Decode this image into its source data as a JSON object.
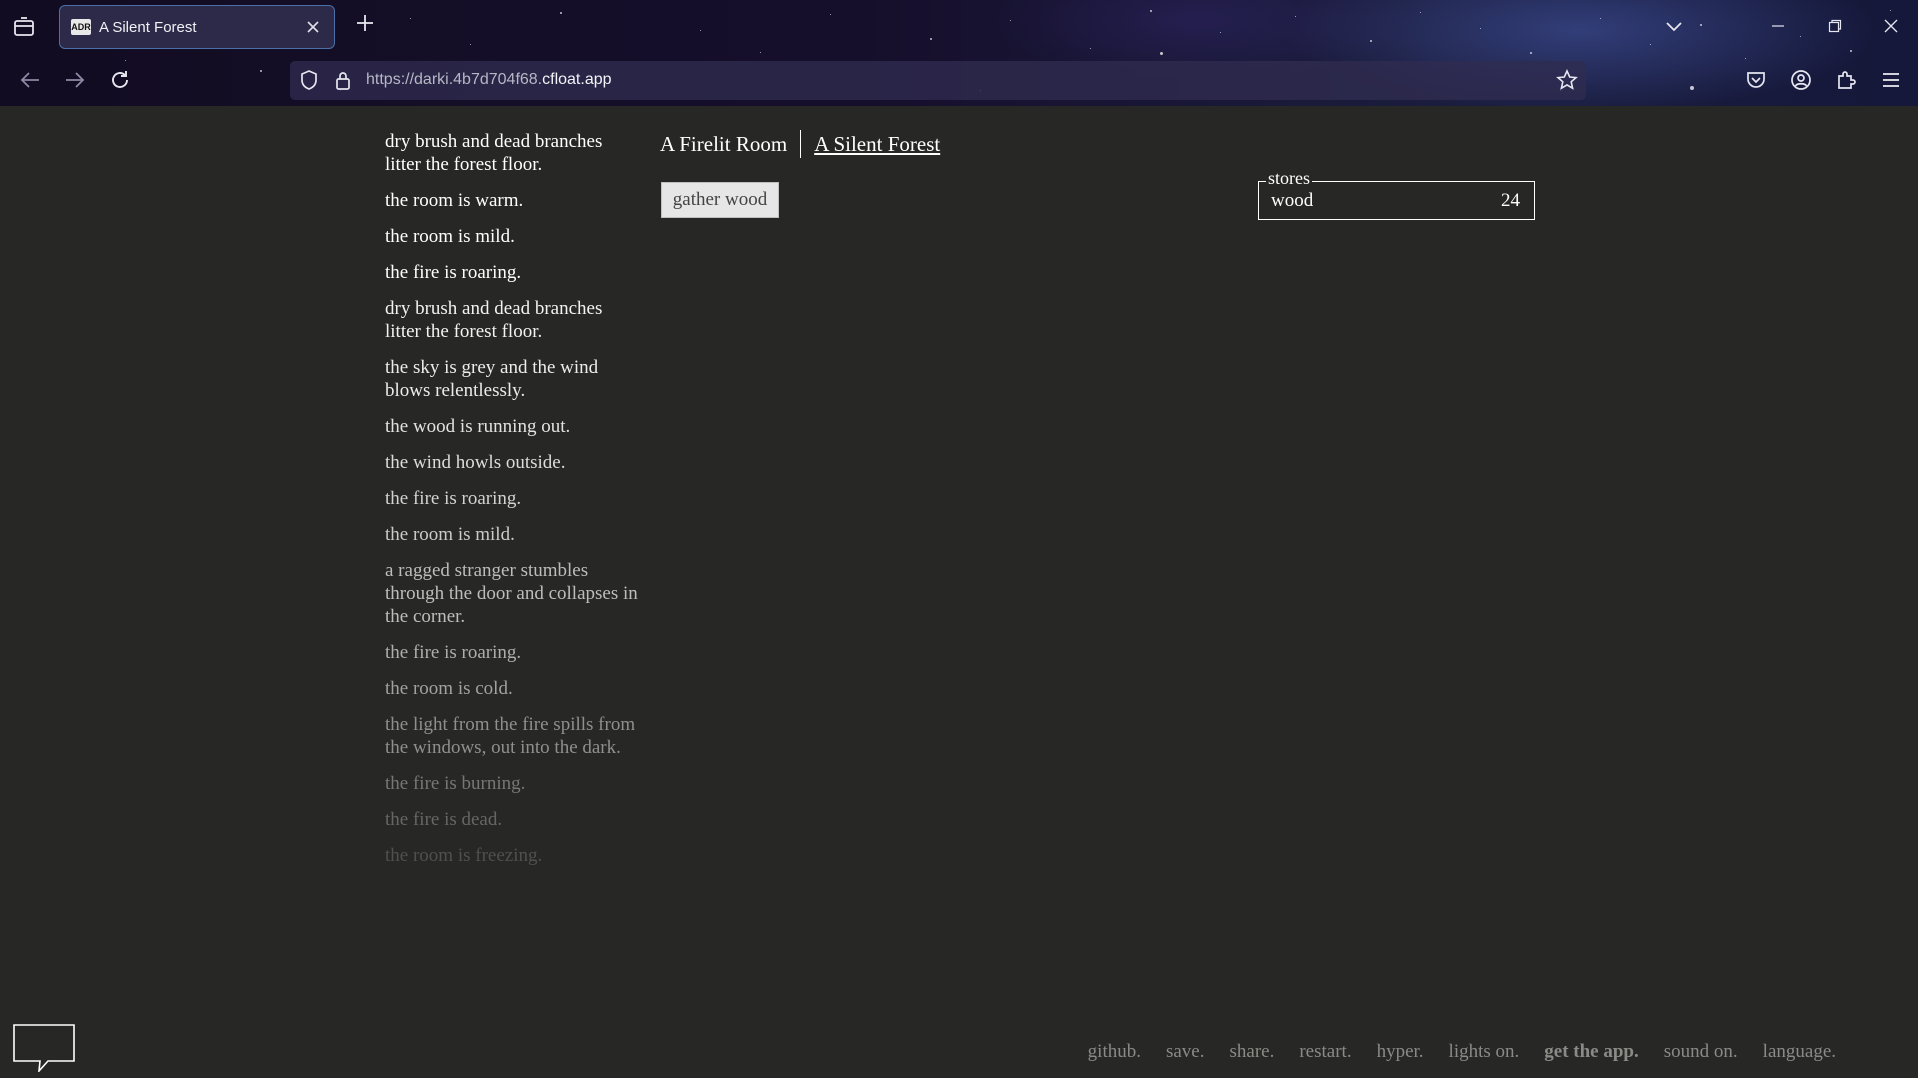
{
  "browser": {
    "tab_title": "A Silent Forest",
    "tab_favicon_text": "ADR",
    "url_prefix": "https://darki.4b7d704f68.",
    "url_host": "cfloat.app"
  },
  "header": {
    "tabs": [
      {
        "label": "A Firelit Room"
      },
      {
        "label": "A Silent Forest"
      }
    ]
  },
  "actions": {
    "gather_wood": "gather wood"
  },
  "stores": {
    "legend": "stores",
    "items": [
      {
        "name": "wood",
        "value": "24"
      }
    ]
  },
  "notifications": [
    {
      "text": "dry brush and dead branches litter the forest floor.",
      "color": "#ffffff"
    },
    {
      "text": "the room is warm.",
      "color": "#ffffff"
    },
    {
      "text": "the room is mild.",
      "color": "#ffffff"
    },
    {
      "text": "the fire is roaring.",
      "color": "#ffffff"
    },
    {
      "text": "dry brush and dead branches litter the forest floor.",
      "color": "#f2f2f1"
    },
    {
      "text": "the sky is grey and the wind blows relentlessly.",
      "color": "#ececeb"
    },
    {
      "text": "the wood is running out.",
      "color": "#e2e2e0"
    },
    {
      "text": "the wind howls outside.",
      "color": "#dcdcda"
    },
    {
      "text": "the fire is roaring.",
      "color": "#d3d3d1"
    },
    {
      "text": "the room is mild.",
      "color": "#cbcbc9"
    },
    {
      "text": "a ragged stranger stumbles through the door and collapses in the corner.",
      "color": "#bdbdbb"
    },
    {
      "text": "the fire is roaring.",
      "color": "#aeaeac"
    },
    {
      "text": "the room is cold.",
      "color": "#a2a2a0"
    },
    {
      "text": "the light from the fire spills from the windows, out into the dark.",
      "color": "#8f8f8d"
    },
    {
      "text": "the fire is burning.",
      "color": "#777775"
    },
    {
      "text": "the fire is dead.",
      "color": "#666664"
    },
    {
      "text": "the room is freezing.",
      "color": "#50504e"
    }
  ],
  "footer": {
    "links": [
      {
        "label": "github."
      },
      {
        "label": "save."
      },
      {
        "label": "share."
      },
      {
        "label": "restart."
      },
      {
        "label": "hyper."
      },
      {
        "label": "lights on."
      },
      {
        "label": "get the app."
      },
      {
        "label": "sound on."
      },
      {
        "label": "language."
      }
    ]
  }
}
